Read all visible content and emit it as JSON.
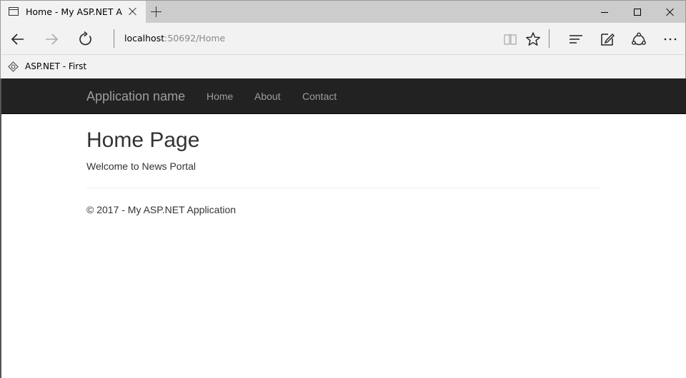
{
  "browser": {
    "tab": {
      "title": "Home - My ASP.NET Ap"
    },
    "address": {
      "host": "localhost",
      "rest": ":50692/Home"
    },
    "favorites": [
      {
        "label": "ASP.NET - First"
      }
    ]
  },
  "site": {
    "brand": "Application name",
    "nav": [
      {
        "label": "Home"
      },
      {
        "label": "About"
      },
      {
        "label": "Contact"
      }
    ],
    "heading": "Home Page",
    "welcome": "Welcome to News Portal",
    "footer": "© 2017 - My ASP.NET Application"
  },
  "colors": {
    "navbar_bg": "#222222",
    "navbar_text": "#9d9d9d",
    "chrome_bg": "#f2f2f2",
    "tabstrip_bg": "#cccccc"
  },
  "icons": {
    "tab": "page-icon",
    "back": "back-arrow-icon",
    "forward": "forward-arrow-icon",
    "refresh": "refresh-icon",
    "reading_view": "reading-view-icon",
    "favorite": "star-icon",
    "hub": "hub-icon",
    "notes": "web-note-icon",
    "share": "share-icon",
    "more": "more-icon"
  }
}
